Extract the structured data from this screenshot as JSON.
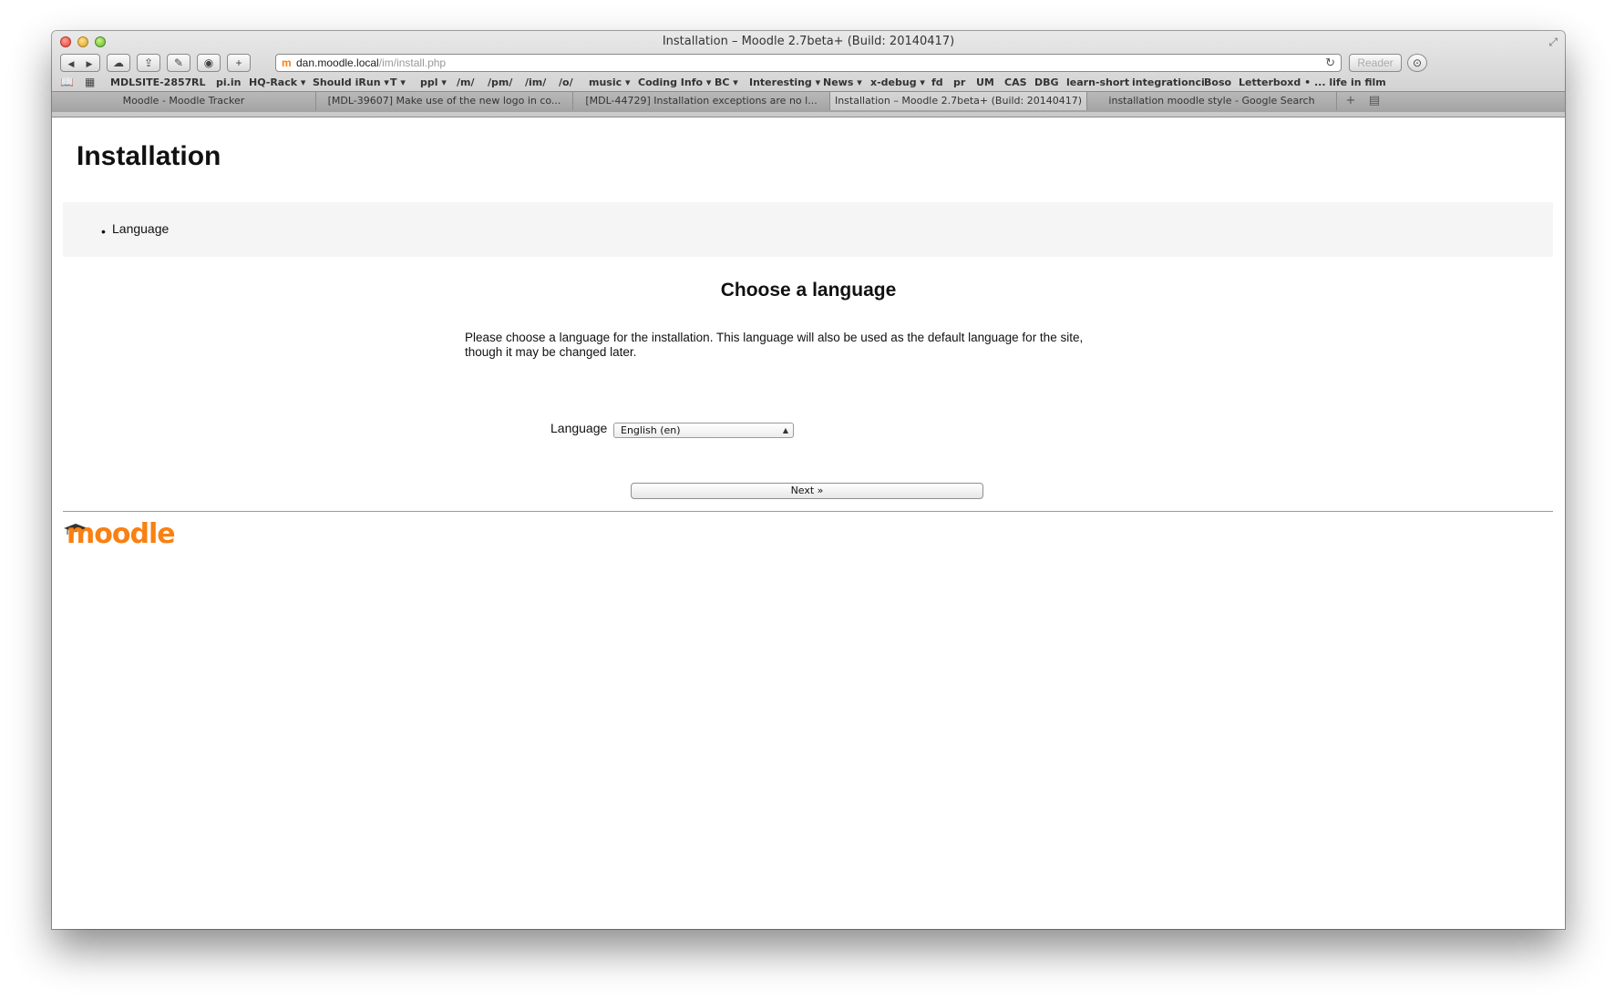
{
  "browser": {
    "window_title": "Installation – Moodle 2.7beta+ (Build: 20140417)",
    "toolbar": {
      "back_glyph": "◀",
      "forward_glyph": "▶",
      "icloud_glyph": "☁",
      "share_glyph": "⇪",
      "tools_glyph": "✎",
      "stop_glyph": "◉",
      "add_glyph": "+",
      "reader_label": "Reader",
      "download_glyph": "⊙"
    },
    "url": {
      "favicon": "m",
      "host": "dan.moodle.local",
      "path": "/im/install.php"
    },
    "bookmarks": [
      {
        "label": "MDLSITE-2857"
      },
      {
        "label": "RL"
      },
      {
        "label": "pi.in"
      },
      {
        "label": "HQ-Rack ▾"
      },
      {
        "label": "Should iRun ▾"
      },
      {
        "label": "T ▾"
      },
      {
        "label": "ppl ▾"
      },
      {
        "label": "/m/"
      },
      {
        "label": "/pm/"
      },
      {
        "label": "/im/"
      },
      {
        "label": "/o/"
      },
      {
        "label": "music ▾"
      },
      {
        "label": "Coding Info ▾"
      },
      {
        "label": "BC ▾"
      },
      {
        "label": "Interesting ▾"
      },
      {
        "label": "News ▾"
      },
      {
        "label": "x-debug ▾"
      },
      {
        "label": "fd"
      },
      {
        "label": "pr"
      },
      {
        "label": "UM"
      },
      {
        "label": "CAS"
      },
      {
        "label": "DBG"
      },
      {
        "label": "learn-short"
      },
      {
        "label": "integrationci"
      },
      {
        "label": "Boso"
      },
      {
        "label": "Letterboxd • ... life in film"
      }
    ],
    "tabs": [
      {
        "label": "Moodle - Moodle Tracker"
      },
      {
        "label": "[MDL-39607] Make use of the new logo in co..."
      },
      {
        "label": "[MDL-44729] Installation exceptions are no l..."
      },
      {
        "label": "Installation – Moodle 2.7beta+ (Build: 20140417)"
      },
      {
        "label": "installation moodle style - Google Search"
      }
    ],
    "active_tab_index": 3
  },
  "page": {
    "heading": "Installation",
    "nav_items": [
      {
        "label": "Language"
      }
    ],
    "section_title": "Choose a language",
    "intro": "Please choose a language for the installation. This language will also be used as the default language for the site, though it may be changed later.",
    "language_field": {
      "label": "Language",
      "selected": "English (en)"
    },
    "next_button": "Next »",
    "logo_text": "moodle",
    "accent_color": "#f98012"
  }
}
